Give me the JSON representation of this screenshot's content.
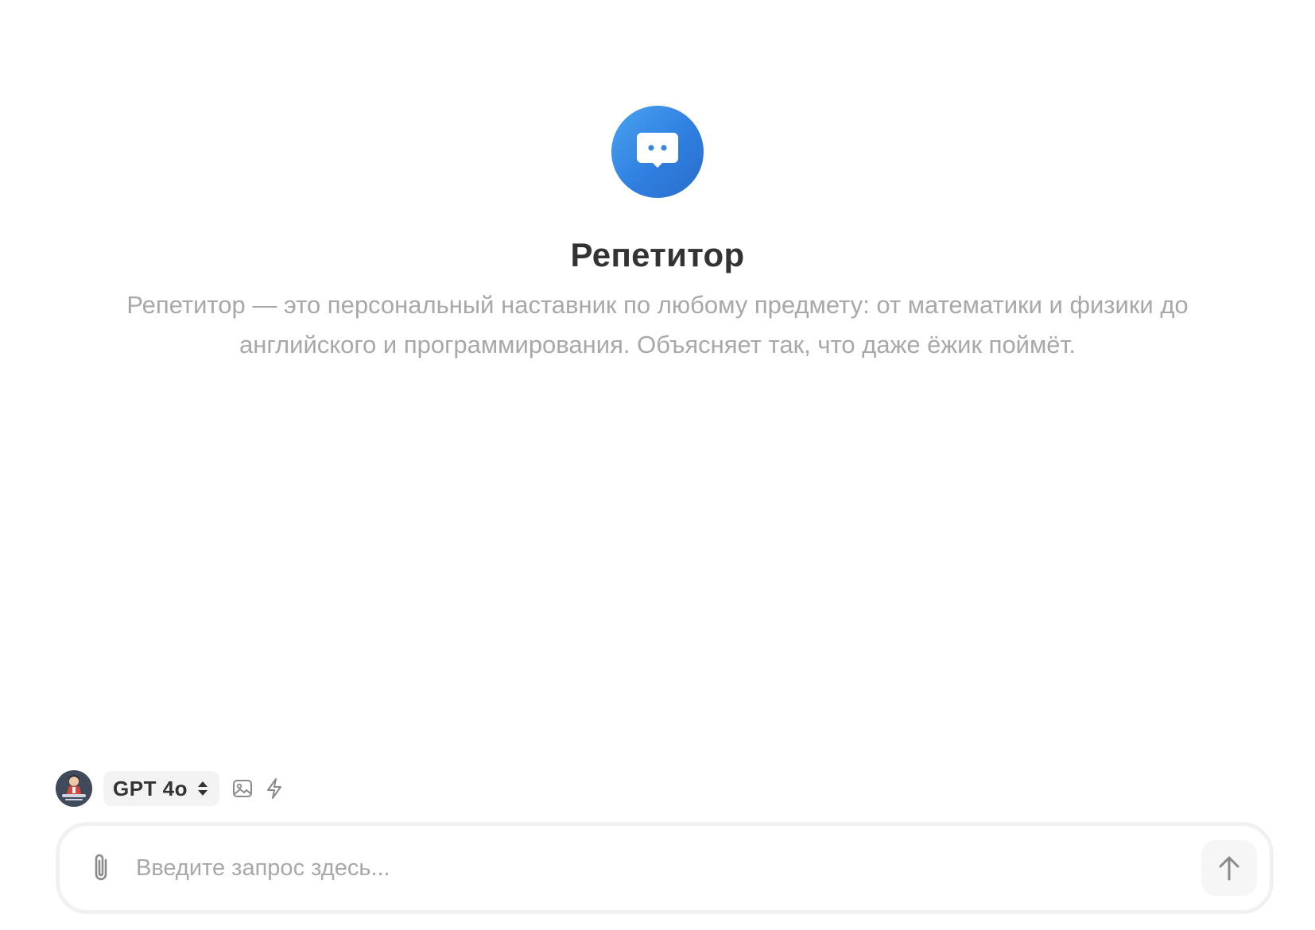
{
  "bot": {
    "icon": "chat-bubble-icon",
    "title": "Репетитор",
    "description": "Репетитор — это персональный наставник по любому предмету: от математики и физики до английского и программирования. Объясняет так, что даже ёжик поймёт.",
    "gradient_from": "#4aa3f0",
    "gradient_to": "#2a6dcc"
  },
  "toolbar": {
    "model_label": "GPT 4o",
    "model_icon": "sort-icon",
    "image_icon": "image-icon",
    "flash_icon": "lightning-icon"
  },
  "input": {
    "placeholder": "Введите запрос здесь...",
    "value": "",
    "attach_icon": "paperclip-icon",
    "send_icon": "arrow-up-icon"
  }
}
